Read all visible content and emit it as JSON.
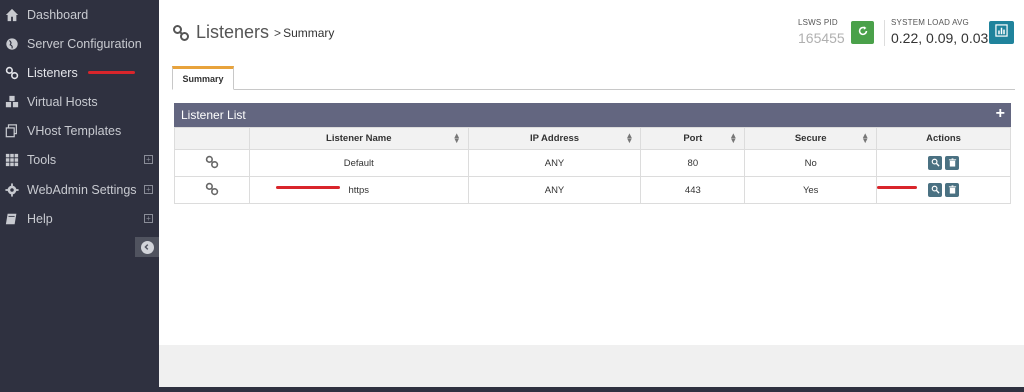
{
  "sidebar": {
    "items": [
      {
        "label": "Dashboard",
        "icon": "home-icon",
        "expandable": false
      },
      {
        "label": "Server Configuration",
        "icon": "globe-icon",
        "expandable": false
      },
      {
        "label": "Listeners",
        "icon": "link-icon",
        "expandable": false
      },
      {
        "label": "Virtual Hosts",
        "icon": "cubes-icon",
        "expandable": false
      },
      {
        "label": "VHost Templates",
        "icon": "copy-icon",
        "expandable": false
      },
      {
        "label": "Tools",
        "icon": "grid-icon",
        "expandable": true
      },
      {
        "label": "WebAdmin Settings",
        "icon": "gear-icon",
        "expandable": true
      },
      {
        "label": "Help",
        "icon": "book-icon",
        "expandable": true
      }
    ]
  },
  "header": {
    "title": "Listeners",
    "separator": ">",
    "subtitle": "Summary",
    "pid_caption": "LSWS PID",
    "pid_value": "165455",
    "load_caption": "SYSTEM LOAD AVG",
    "load_value": "0.22, 0.09, 0.03"
  },
  "tabs": [
    {
      "label": "Summary",
      "active": true
    }
  ],
  "panel": {
    "title": "Listener List",
    "add_symbol": "+",
    "columns": [
      "Listener Name",
      "IP Address",
      "Port",
      "Secure",
      "Actions"
    ],
    "rows": [
      {
        "name": "Default",
        "ip": "ANY",
        "port": "80",
        "secure": "No"
      },
      {
        "name": "https",
        "ip": "ANY",
        "port": "443",
        "secure": "Yes"
      }
    ]
  },
  "colors": {
    "sidebar_bg": "#2f3140",
    "panel_header": "#636680",
    "tab_accent": "#e8a33c",
    "refresh_button": "#4aa14a",
    "chart_button": "#20839c",
    "action_button": "#4a7182",
    "annotation_red": "#d9252b"
  }
}
